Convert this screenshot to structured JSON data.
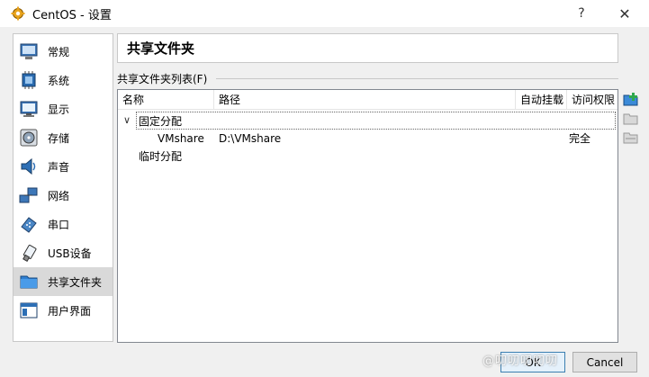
{
  "window": {
    "title": "CentOS - 设置",
    "help_glyph": "?",
    "close_glyph": "✕"
  },
  "sidebar": {
    "items": [
      {
        "label": "常规",
        "icon": "general-icon"
      },
      {
        "label": "系统",
        "icon": "system-chip-icon"
      },
      {
        "label": "显示",
        "icon": "display-monitor-icon"
      },
      {
        "label": "存储",
        "icon": "storage-disk-icon"
      },
      {
        "label": "声音",
        "icon": "audio-speaker-icon"
      },
      {
        "label": "网络",
        "icon": "network-icon"
      },
      {
        "label": "串口",
        "icon": "serial-port-icon"
      },
      {
        "label": "USB设备",
        "icon": "usb-icon"
      },
      {
        "label": "共享文件夹",
        "icon": "shared-folder-icon"
      },
      {
        "label": "用户界面",
        "icon": "user-interface-icon"
      }
    ],
    "selected_index": 8
  },
  "page": {
    "title": "共享文件夹",
    "section_label": "共享文件夹列表(F)"
  },
  "table": {
    "columns": [
      "名称",
      "路径",
      "自动挂载",
      "访问权限"
    ],
    "rows": [
      {
        "type": "group",
        "name": "固定分配",
        "expanded_glyph": "∨"
      },
      {
        "type": "item",
        "name": "VMshare",
        "path": "D:\\VMshare",
        "automount": "",
        "access": "完全"
      },
      {
        "type": "group",
        "name": "临时分配",
        "expanded_glyph": ""
      }
    ]
  },
  "tools": {
    "add": "add-shared-folder-icon",
    "edit": "edit-shared-folder-icon",
    "remove": "remove-shared-folder-icon"
  },
  "buttons": {
    "ok": "OK",
    "cancel": "Cancel"
  },
  "watermark": "@叨叨叨叨叨",
  "colors": {
    "selection": "#d9d9d9",
    "ok_border": "#3c7fb1",
    "add_icon_green": "#2fa84f"
  }
}
